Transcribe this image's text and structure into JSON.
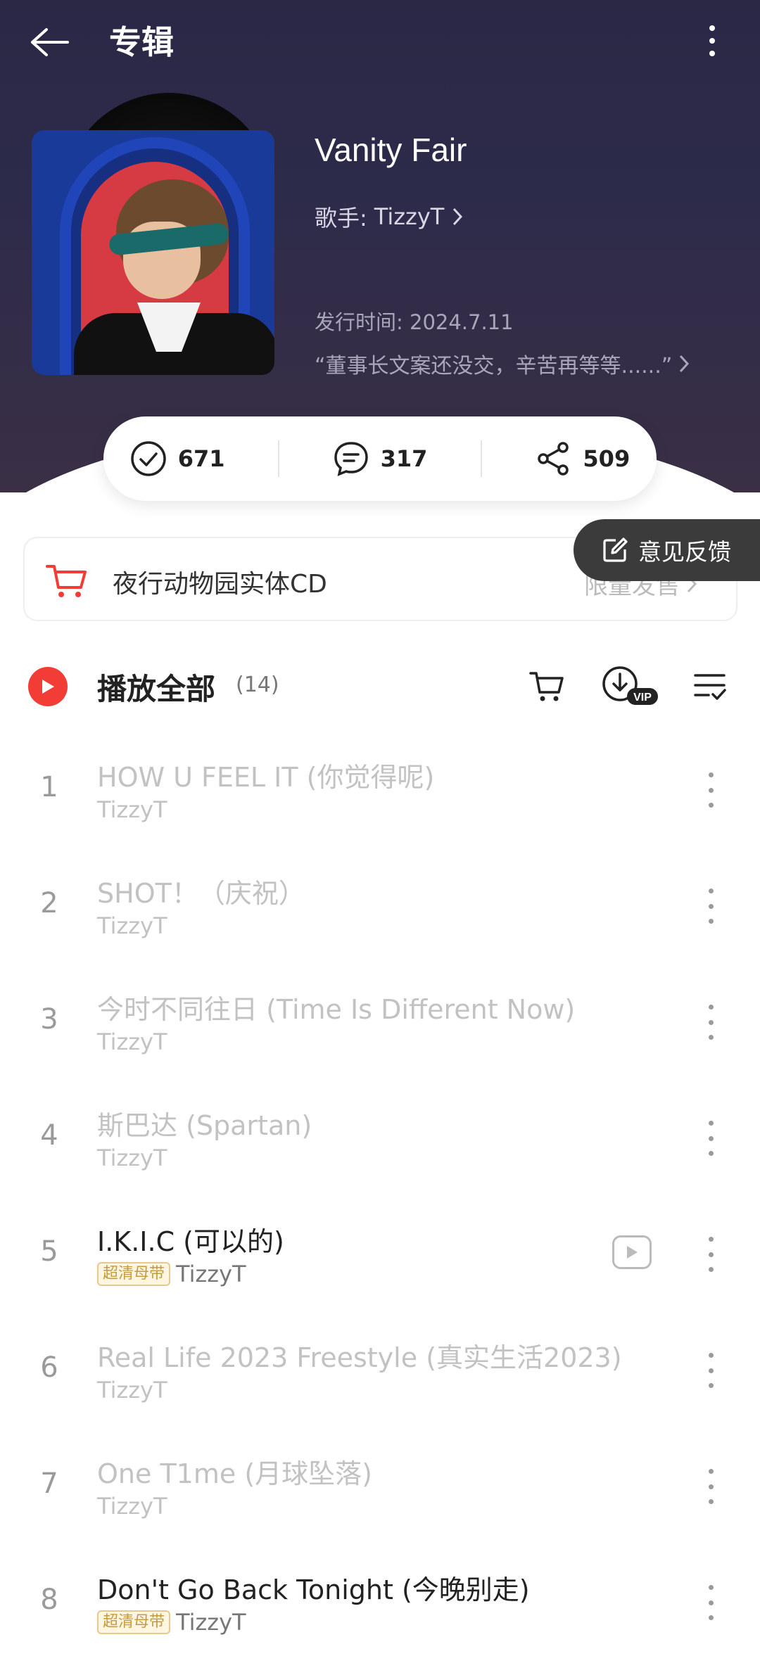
{
  "header": {
    "title": "专辑"
  },
  "album": {
    "name": "Vanity Fair",
    "artist_prefix": "歌手:",
    "artist": "TizzyT",
    "release": "发行时间: 2024.7.11",
    "description": "“董事长文案还没交，辛苦再等等......”"
  },
  "stats": {
    "favorites": "671",
    "comments": "317",
    "shares": "509"
  },
  "cd_banner": {
    "label": "夜行动物园实体CD",
    "limited": "限量发售"
  },
  "feedback": {
    "label": "意见反馈"
  },
  "playall": {
    "label": "播放全部",
    "count": "(14)"
  },
  "tracks": [
    {
      "num": "1",
      "name": "HOW U FEEL IT (你觉得呢)",
      "artist": "TizzyT",
      "badge": "",
      "active": false,
      "mv": false
    },
    {
      "num": "2",
      "name": "SHOT！（庆祝）",
      "artist": "TizzyT",
      "badge": "",
      "active": false,
      "mv": false
    },
    {
      "num": "3",
      "name": "今时不同往日 (Time Is Different Now)",
      "artist": "TizzyT",
      "badge": "",
      "active": false,
      "mv": false
    },
    {
      "num": "4",
      "name": "斯巴达 (Spartan)",
      "artist": "TizzyT",
      "badge": "",
      "active": false,
      "mv": false
    },
    {
      "num": "5",
      "name": "I.K.I.C (可以的)",
      "artist": "TizzyT",
      "badge": "超清母带",
      "active": true,
      "mv": true
    },
    {
      "num": "6",
      "name": "Real Life 2023 Freestyle (真实生活2023)",
      "artist": "TizzyT",
      "badge": "",
      "active": false,
      "mv": false
    },
    {
      "num": "7",
      "name": "One T1me (月球坠落)",
      "artist": "TizzyT",
      "badge": "",
      "active": false,
      "mv": false
    },
    {
      "num": "8",
      "name": "Don't Go Back Tonight (今晚别走)",
      "artist": "TizzyT",
      "badge": "超清母带",
      "active": true,
      "mv": false
    }
  ],
  "colors": {
    "accent": "#f23c36",
    "hero": "#2d2b4a"
  },
  "icons": {
    "back": "arrow-left-icon",
    "more": "more-vertical-icon",
    "cart": "cart-icon",
    "download": "download-vip-icon",
    "multiselect": "list-check-icon"
  }
}
